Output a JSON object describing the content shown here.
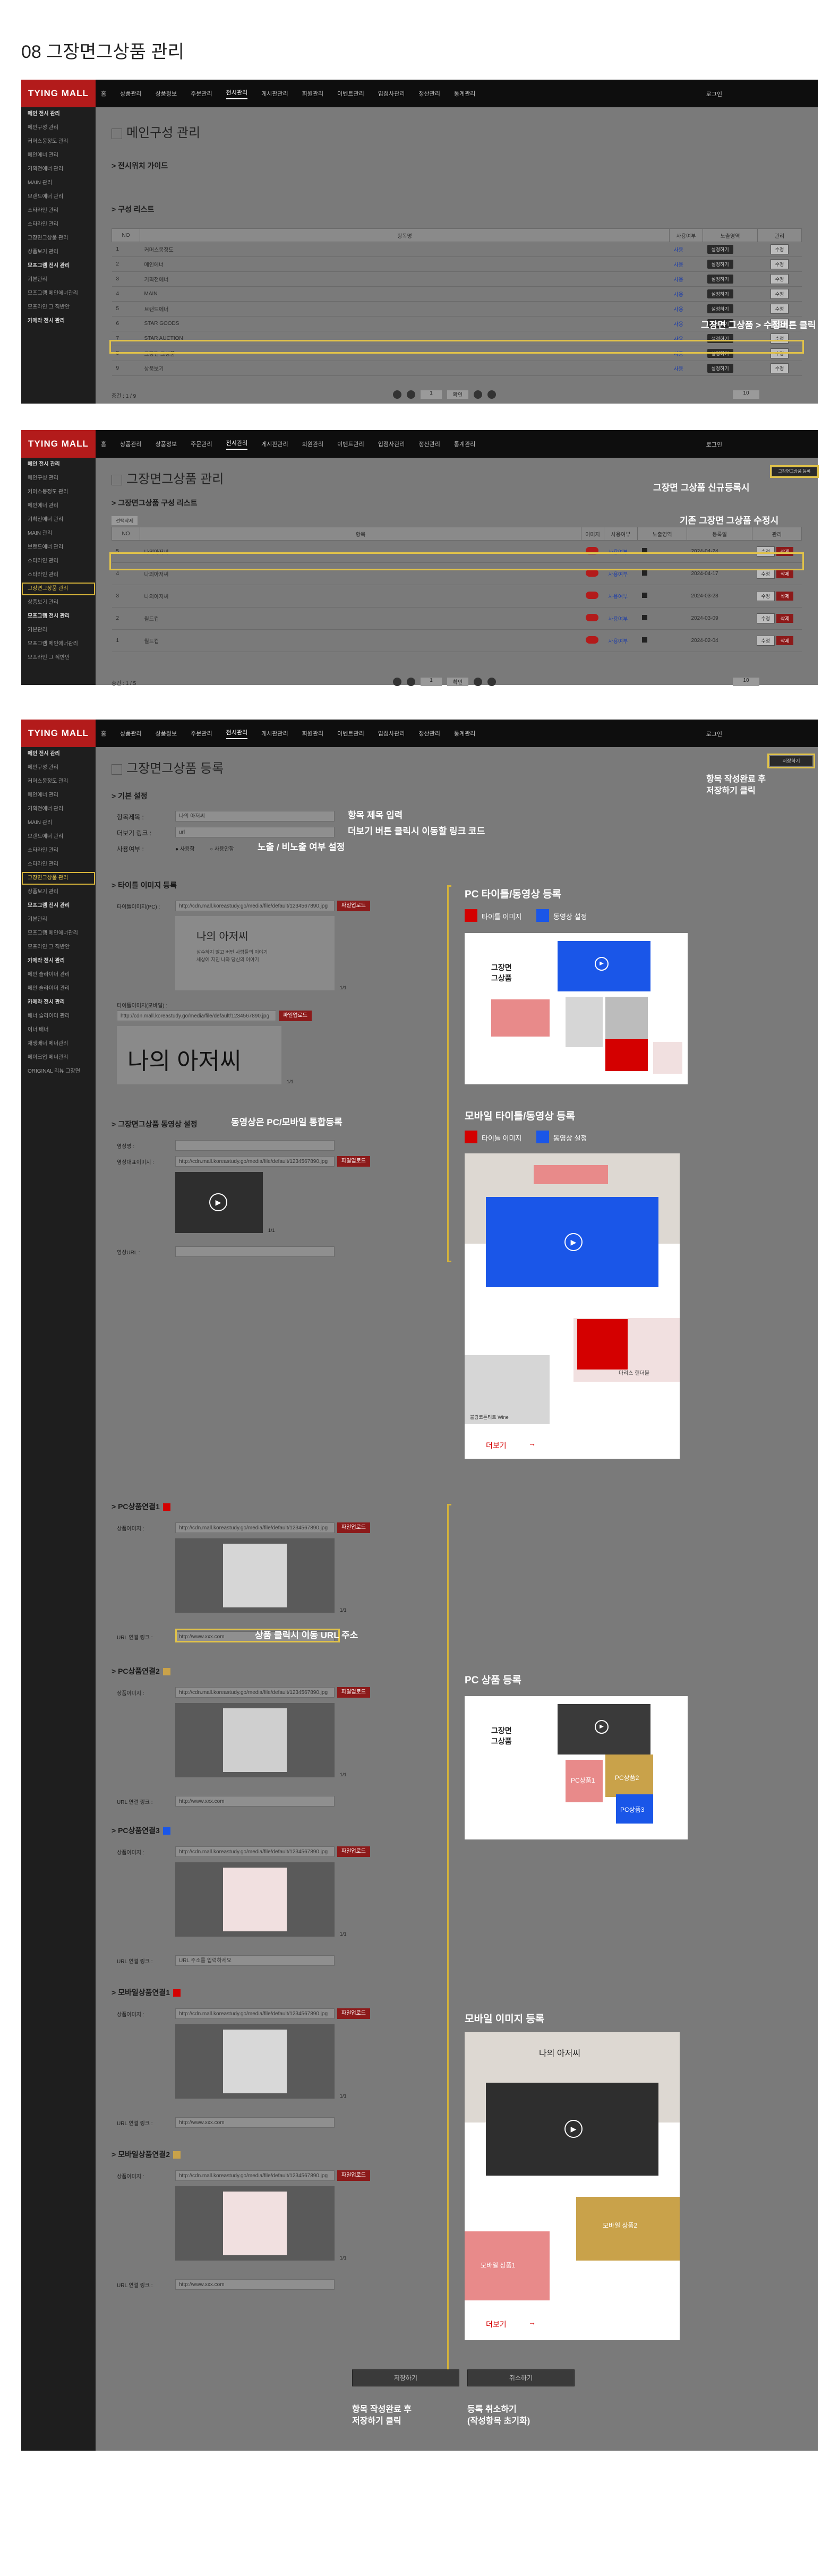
{
  "page_title": "08 그장면그상품 관리",
  "app": {
    "logo": "TYING MALL",
    "topnav": [
      "홈",
      "상품관리",
      "상품정보",
      "주문관리",
      "전시관리",
      "게시판관리",
      "회원관리",
      "이벤트관리",
      "입점사관리",
      "정산관리",
      "통계관리"
    ],
    "active_nav": "전시관리",
    "login": "로그인"
  },
  "shot1": {
    "sidebar": [
      "메인 전시 관리",
      "메인구성 관리",
      "커머스몽정도 관리",
      "메인에너 관리",
      "기획전에너 관리",
      "MAIN 관리",
      "브랜드에너 관리",
      "스타라인 관리",
      "스타라인 관리",
      "그장면그상품 관리",
      "상품보기 관리",
      "모프그램 전시 관리",
      "기본관리",
      "모프그램 메인에너관리",
      "모프라인 그 직반안",
      "카메라 전시 관리"
    ],
    "title": "메인구성 관리",
    "section1": "전시위치 가이드",
    "section2": "구성 리스트",
    "table_headers": [
      "NO",
      "항목명",
      "사용여부",
      "노출영역",
      "관리"
    ],
    "rows": [
      {
        "no": "1",
        "name": "커머스몽정도",
        "use": "사용",
        "area": "설정하기",
        "btn": "수정"
      },
      {
        "no": "2",
        "name": "메인에너",
        "use": "사용",
        "area": "설정하기",
        "btn": "수정"
      },
      {
        "no": "3",
        "name": "기획전에너",
        "use": "사용",
        "area": "설정하기",
        "btn": "수정"
      },
      {
        "no": "4",
        "name": "MAIN",
        "use": "사용",
        "area": "설정하기",
        "btn": "수정"
      },
      {
        "no": "5",
        "name": "브랜드에너",
        "use": "사용",
        "area": "설정하기",
        "btn": "수정"
      },
      {
        "no": "6",
        "name": "STAR GOODS",
        "use": "사용",
        "area": "설정하기",
        "btn": "수정"
      },
      {
        "no": "7",
        "name": "STAR AUCTION",
        "use": "사용",
        "area": "설정하기",
        "btn": "수정"
      },
      {
        "no": "8",
        "name": "그장면 그상품",
        "use": "사용",
        "area": "설정하기",
        "btn": "수정"
      },
      {
        "no": "9",
        "name": "상품보기",
        "use": "사용",
        "area": "설정하기",
        "btn": "수정"
      }
    ],
    "total": "총건 : 1 / 9",
    "note": "그장면 그상품 > 수정버튼 클릭",
    "page_num": "1",
    "page_btn": "확인",
    "page_size": "10"
  },
  "shot2": {
    "sidebar": [
      "메인 전시 관리",
      "메인구성 관리",
      "커머스몽정도 관리",
      "메인에너 관리",
      "기획전에너 관리",
      "MAIN 관리",
      "브랜드에너 관리",
      "스타라인 관리",
      "스타라인 관리",
      "그장면그상품 관리",
      "상품보기 관리",
      "모프그램 전시 관리",
      "기본관리",
      "모프그램 메인에너관리",
      "모프라인 그 직반안"
    ],
    "title": "그장면그상품 관리",
    "section": "그장면그상품 구성 리스트",
    "new_btn": "그장면그상품 등록",
    "delete_btn": "선택삭제",
    "table_headers": [
      "NO",
      "항목",
      "이미지",
      "사용여부",
      "노출영역",
      "등록일",
      "관리"
    ],
    "rows": [
      {
        "no": "5",
        "name": "나의아저씨",
        "use": "사용여부",
        "date": "2024-04-24"
      },
      {
        "no": "4",
        "name": "나의아저씨",
        "use": "사용여부",
        "date": "2024-04-17"
      },
      {
        "no": "3",
        "name": "나의아저씨",
        "use": "사용여부",
        "date": "2024-03-28"
      },
      {
        "no": "2",
        "name": "월드컵",
        "use": "사용여부",
        "date": "2024-03-09"
      },
      {
        "no": "1",
        "name": "월드컵",
        "use": "사용여부",
        "date": "2024-02-04"
      }
    ],
    "total": "총건 : 1 / 5",
    "note1": "그장면 그상품 신규등록시",
    "note2": "기존 그장면 그상품 수정시\n수정버튼클릭",
    "edit_btn": "수정",
    "del_btn": "삭제"
  },
  "shot3": {
    "sidebar": [
      "메인 전시 관리",
      "메인구성 관리",
      "커머스몽정도 관리",
      "메인에너 관리",
      "기획전에너 관리",
      "MAIN 관리",
      "브랜드에너 관리",
      "스타라인 관리",
      "스타라인 관리",
      "그장면그상품 관리",
      "상품보기 관리",
      "모프그램 전시 관리",
      "기본관리",
      "모프그램 메인에너관리",
      "모프라인 그 직반안",
      "카메라 전시 관리",
      "메인 슬라이더 관리",
      "메인 슬라이더 관리",
      "카메라 전시 관리",
      "배너 슬라이더 관리",
      "이너 배너",
      "재생배너 메너관리",
      "메이크업 메너관리",
      "ORIGINAL 리뷰 그장면"
    ],
    "title": "그장면그상품 등록",
    "save_btn_top": "저장하기",
    "note_save_top": "항목 작성완료 후\n저장하기 클릭",
    "basic_section": "기본 설정",
    "label_title": "항목제목 :",
    "value_title": "나의 아저씨",
    "label_link": "더보기 링크 :",
    "value_link": "url",
    "label_show": "사용여부 :",
    "opt_show": "사용함",
    "opt_hide": "사용안함",
    "note_title": "항목 제목 입력",
    "note_link": "더보기 버튼 클릭시 이동할 링크 코드",
    "note_show": "노출 / 비노출 여부 설정",
    "title_img_section": "타이틀 이미지 등록",
    "label_pc_title": "타이틀이미지(PC) :",
    "label_mo_title": "타이틀이미지(모바일) :",
    "img_url": "http://cdn.mall.koreastudy.go/media/file/default/1234567890.jpg",
    "upload_btn": "파일업로드",
    "img_limit": "1/1",
    "title_text_ko": "나의 아저씨",
    "title_para": "삼수하지 않고 버틴 사람들의 이야기\n세상에 지친 나와 당신의 이야기",
    "video_section": "그장면그상품 동영상 설정",
    "note_video": "동영상은 PC/모바일 통합등록",
    "label_video_title": "영상명 :",
    "label_video_thumb": "영상대표이미지 :",
    "label_video_url": "영상URL :",
    "pc_title_head": "PC 타이틀/동영상 등록",
    "legend_title_img": "타이틀 이미지",
    "legend_video": "동영상 설정",
    "mo_title_head": "모바일 타이틀/동영상 등록",
    "pv_scene_title": "그장면\n그상품",
    "pv_more": "더보기",
    "pv_bag_label": "마리스 핸더블",
    "pv_product_caption": "블랑코튼티트 Wine",
    "pc_prod1": "PC상품연결1",
    "pc_prod2": "PC상품연결2",
    "pc_prod3": "PC상품연결3",
    "mo_prod1": "모바일상품연결1",
    "mo_prod2": "모바일상품연결2",
    "label_prod_img": "상품이미지 :",
    "label_prod_url": "URL 연결 링크 :",
    "prod_url_value": "http://www.xxx.com",
    "prod_url_placeholder": "URL 주소를 입력하세요",
    "note_prod_url": "상품 클릭시 이동 URL 주소",
    "pc_product_head": "PC 상품 등록",
    "pv_pc_prod1": "PC상품1",
    "pv_pc_prod2": "PC상품2",
    "pv_pc_prod3": "PC상품3",
    "mobile_img_head": "모바일 이미지 등록",
    "pv_mo_prod1": "모바일 상품1",
    "pv_mo_prod2": "모바일 상품2",
    "bottom_save": "저장하기",
    "bottom_cancel": "취소하기",
    "note_bottom_save": "항목 작성완료 후\n저장하기 클릭",
    "note_bottom_cancel": "등록 취소하기\n(작성항목 초기화)"
  },
  "colors": {
    "red": "#d40000",
    "blue": "#1a56e8",
    "yellow": "#d4b23a",
    "pink": "#e88a8a",
    "gold": "#c9a24a"
  }
}
